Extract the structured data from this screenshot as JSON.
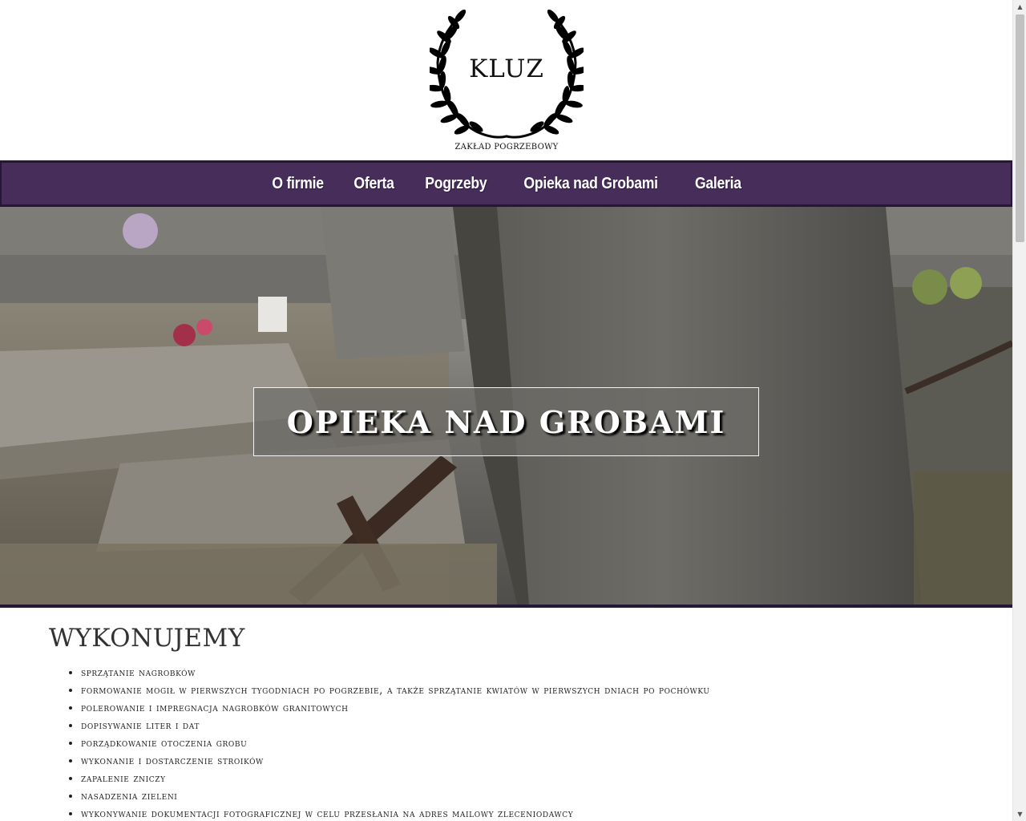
{
  "logo": {
    "title": "KLUZ",
    "subtitle": "ZAKŁAD POGRZEBOWY",
    "icon": "laurel-wreath-icon"
  },
  "nav": {
    "items": [
      {
        "label": "O firmie"
      },
      {
        "label": "Oferta"
      },
      {
        "label": "Pogrzeby"
      },
      {
        "label": "Opieka nad Grobami"
      },
      {
        "label": "Galeria"
      }
    ]
  },
  "hero": {
    "title": "OPIEKA NAD GROBAMI"
  },
  "section": {
    "title": "WYKONUJEMY",
    "items": [
      "sprzątanie nagrobków",
      "formowanie mogił w pierwszych tygodniach po pogrzebie, a także sprzątanie kwiatów w pierwszych dniach po pochówku",
      "polerowanie i impregnacja nagrobków granitowych",
      "dopisywanie liter i dat",
      "porządkowanie otoczenia grobu",
      "wykonanie i dostarczenie stroików",
      "zapalenie zniczy",
      "nasadzenia zieleni",
      "wykonywanie dokumentacji fotograficznej w celu przesłania na adres mailowy zleceniodawcy"
    ]
  },
  "colors": {
    "nav_background": "#472d5a",
    "nav_border": "#241832"
  }
}
